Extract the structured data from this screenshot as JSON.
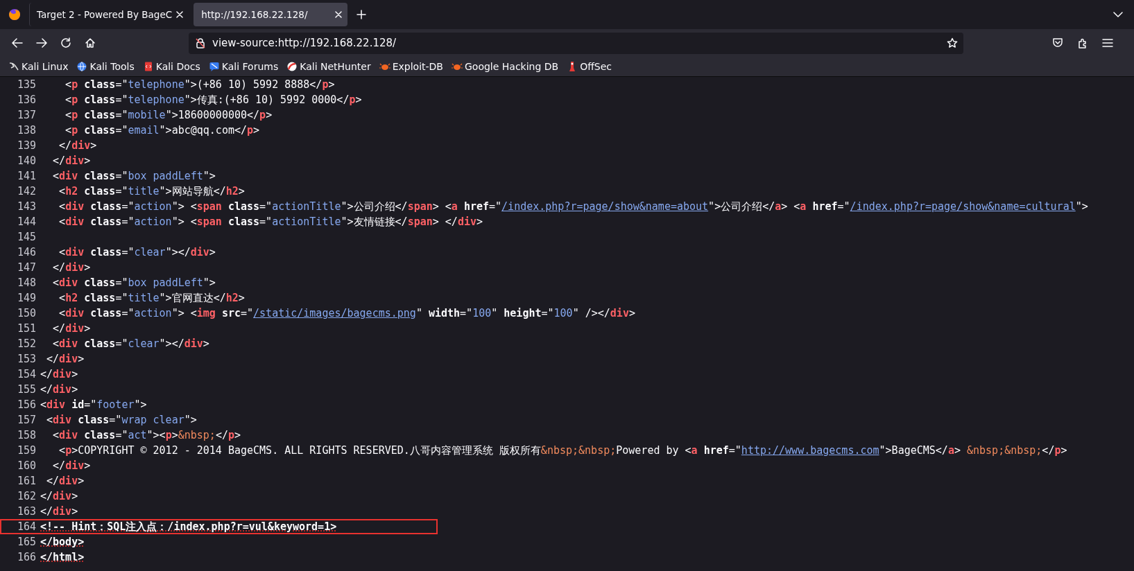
{
  "tabs": [
    {
      "title": "Target 2 - Powered By BageC",
      "selected": false
    },
    {
      "title": "http://192.168.22.128/",
      "selected": true
    }
  ],
  "address_bar": {
    "value": "view-source:http://192.168.22.128/"
  },
  "bookmarks": [
    {
      "label": "Kali Linux"
    },
    {
      "label": "Kali Tools"
    },
    {
      "label": "Kali Docs"
    },
    {
      "label": "Kali Forums"
    },
    {
      "label": "Kali NetHunter"
    },
    {
      "label": "Exploit-DB"
    },
    {
      "label": "Google Hacking DB"
    },
    {
      "label": "OffSec"
    }
  ],
  "source_lines": [
    {
      "number": "135",
      "highlighted": false,
      "tokens": [
        {
          "kind": "text",
          "text": "    <"
        },
        {
          "kind": "tag",
          "text": "p"
        },
        {
          "kind": "attr",
          "text": " class"
        },
        {
          "kind": "text",
          "text": "=\""
        },
        {
          "kind": "value",
          "text": "telephone"
        },
        {
          "kind": "text",
          "text": "\">(+86 10) 5992 8888</"
        },
        {
          "kind": "tag",
          "text": "p"
        },
        {
          "kind": "text",
          "text": ">"
        }
      ]
    },
    {
      "number": "136",
      "highlighted": false,
      "tokens": [
        {
          "kind": "text",
          "text": "    <"
        },
        {
          "kind": "tag",
          "text": "p"
        },
        {
          "kind": "attr",
          "text": " class"
        },
        {
          "kind": "text",
          "text": "=\""
        },
        {
          "kind": "value",
          "text": "telephone"
        },
        {
          "kind": "text",
          "text": "\">传真:(+86 10) 5992 0000</"
        },
        {
          "kind": "tag",
          "text": "p"
        },
        {
          "kind": "text",
          "text": ">"
        }
      ]
    },
    {
      "number": "137",
      "highlighted": false,
      "tokens": [
        {
          "kind": "text",
          "text": "    <"
        },
        {
          "kind": "tag",
          "text": "p"
        },
        {
          "kind": "attr",
          "text": " class"
        },
        {
          "kind": "text",
          "text": "=\""
        },
        {
          "kind": "value",
          "text": "mobile"
        },
        {
          "kind": "text",
          "text": "\">18600000000</"
        },
        {
          "kind": "tag",
          "text": "p"
        },
        {
          "kind": "text",
          "text": ">"
        }
      ]
    },
    {
      "number": "138",
      "highlighted": false,
      "tokens": [
        {
          "kind": "text",
          "text": "    <"
        },
        {
          "kind": "tag",
          "text": "p"
        },
        {
          "kind": "attr",
          "text": " class"
        },
        {
          "kind": "text",
          "text": "=\""
        },
        {
          "kind": "value",
          "text": "email"
        },
        {
          "kind": "text",
          "text": "\">abc@qq.com</"
        },
        {
          "kind": "tag",
          "text": "p"
        },
        {
          "kind": "text",
          "text": ">"
        }
      ]
    },
    {
      "number": "139",
      "highlighted": false,
      "tokens": [
        {
          "kind": "text",
          "text": "   </"
        },
        {
          "kind": "tag",
          "text": "div"
        },
        {
          "kind": "text",
          "text": ">"
        }
      ]
    },
    {
      "number": "140",
      "highlighted": false,
      "tokens": [
        {
          "kind": "text",
          "text": "  </"
        },
        {
          "kind": "tag",
          "text": "div"
        },
        {
          "kind": "text",
          "text": ">"
        }
      ]
    },
    {
      "number": "141",
      "highlighted": false,
      "tokens": [
        {
          "kind": "text",
          "text": "  <"
        },
        {
          "kind": "tag",
          "text": "div"
        },
        {
          "kind": "attr",
          "text": " class"
        },
        {
          "kind": "text",
          "text": "=\""
        },
        {
          "kind": "value",
          "text": "box paddLeft"
        },
        {
          "kind": "text",
          "text": "\">"
        }
      ]
    },
    {
      "number": "142",
      "highlighted": false,
      "tokens": [
        {
          "kind": "text",
          "text": "   <"
        },
        {
          "kind": "tag",
          "text": "h2"
        },
        {
          "kind": "attr",
          "text": " class"
        },
        {
          "kind": "text",
          "text": "=\""
        },
        {
          "kind": "value",
          "text": "title"
        },
        {
          "kind": "text",
          "text": "\">网站导航</"
        },
        {
          "kind": "tag",
          "text": "h2"
        },
        {
          "kind": "text",
          "text": ">"
        }
      ]
    },
    {
      "number": "143",
      "highlighted": false,
      "tokens": [
        {
          "kind": "text",
          "text": "   <"
        },
        {
          "kind": "tag",
          "text": "div"
        },
        {
          "kind": "attr",
          "text": " class"
        },
        {
          "kind": "text",
          "text": "=\""
        },
        {
          "kind": "value",
          "text": "action"
        },
        {
          "kind": "text",
          "text": "\"> <"
        },
        {
          "kind": "tag",
          "text": "span"
        },
        {
          "kind": "attr",
          "text": " class"
        },
        {
          "kind": "text",
          "text": "=\""
        },
        {
          "kind": "value",
          "text": "actionTitle"
        },
        {
          "kind": "text",
          "text": "\">公司介绍</"
        },
        {
          "kind": "tag",
          "text": "span"
        },
        {
          "kind": "text",
          "text": "> <"
        },
        {
          "kind": "tag",
          "text": "a"
        },
        {
          "kind": "attr",
          "text": " href"
        },
        {
          "kind": "text",
          "text": "=\""
        },
        {
          "kind": "link",
          "text": "/index.php?r=page/show&name=about"
        },
        {
          "kind": "text",
          "text": "\">公司介绍</"
        },
        {
          "kind": "tag",
          "text": "a"
        },
        {
          "kind": "text",
          "text": "> <"
        },
        {
          "kind": "tag",
          "text": "a"
        },
        {
          "kind": "attr",
          "text": " href"
        },
        {
          "kind": "text",
          "text": "=\""
        },
        {
          "kind": "link",
          "text": "/index.php?r=page/show&name=cultural"
        },
        {
          "kind": "text",
          "text": "\">"
        }
      ]
    },
    {
      "number": "144",
      "highlighted": false,
      "tokens": [
        {
          "kind": "text",
          "text": "   <"
        },
        {
          "kind": "tag",
          "text": "div"
        },
        {
          "kind": "attr",
          "text": " class"
        },
        {
          "kind": "text",
          "text": "=\""
        },
        {
          "kind": "value",
          "text": "action"
        },
        {
          "kind": "text",
          "text": "\"> <"
        },
        {
          "kind": "tag",
          "text": "span"
        },
        {
          "kind": "attr",
          "text": " class"
        },
        {
          "kind": "text",
          "text": "=\""
        },
        {
          "kind": "value",
          "text": "actionTitle"
        },
        {
          "kind": "text",
          "text": "\">友情链接</"
        },
        {
          "kind": "tag",
          "text": "span"
        },
        {
          "kind": "text",
          "text": "> </"
        },
        {
          "kind": "tag",
          "text": "div"
        },
        {
          "kind": "text",
          "text": ">"
        }
      ]
    },
    {
      "number": "145",
      "highlighted": false
    },
    {
      "number": "146",
      "highlighted": false,
      "tokens": [
        {
          "kind": "text",
          "text": "   <"
        },
        {
          "kind": "tag",
          "text": "div"
        },
        {
          "kind": "attr",
          "text": " class"
        },
        {
          "kind": "text",
          "text": "=\""
        },
        {
          "kind": "value",
          "text": "clear"
        },
        {
          "kind": "text",
          "text": "\"></"
        },
        {
          "kind": "tag",
          "text": "div"
        },
        {
          "kind": "text",
          "text": ">"
        }
      ]
    },
    {
      "number": "147",
      "highlighted": false,
      "tokens": [
        {
          "kind": "text",
          "text": "  </"
        },
        {
          "kind": "tag",
          "text": "div"
        },
        {
          "kind": "text",
          "text": ">"
        }
      ]
    },
    {
      "number": "148",
      "highlighted": false,
      "tokens": [
        {
          "kind": "text",
          "text": "  <"
        },
        {
          "kind": "tag",
          "text": "div"
        },
        {
          "kind": "attr",
          "text": " class"
        },
        {
          "kind": "text",
          "text": "=\""
        },
        {
          "kind": "value",
          "text": "box paddLeft"
        },
        {
          "kind": "text",
          "text": "\">"
        }
      ]
    },
    {
      "number": "149",
      "highlighted": false,
      "tokens": [
        {
          "kind": "text",
          "text": "   <"
        },
        {
          "kind": "tag",
          "text": "h2"
        },
        {
          "kind": "attr",
          "text": " class"
        },
        {
          "kind": "text",
          "text": "=\""
        },
        {
          "kind": "value",
          "text": "title"
        },
        {
          "kind": "text",
          "text": "\">官网直达</"
        },
        {
          "kind": "tag",
          "text": "h2"
        },
        {
          "kind": "text",
          "text": ">"
        }
      ]
    },
    {
      "number": "150",
      "highlighted": false,
      "tokens": [
        {
          "kind": "text",
          "text": "   <"
        },
        {
          "kind": "tag",
          "text": "div"
        },
        {
          "kind": "attr",
          "text": " class"
        },
        {
          "kind": "text",
          "text": "=\""
        },
        {
          "kind": "value",
          "text": "action"
        },
        {
          "kind": "text",
          "text": "\"> <"
        },
        {
          "kind": "tag",
          "text": "img"
        },
        {
          "kind": "attr",
          "text": " src"
        },
        {
          "kind": "text",
          "text": "=\""
        },
        {
          "kind": "link",
          "text": "/static/images/bagecms.png"
        },
        {
          "kind": "text",
          "text": "\""
        },
        {
          "kind": "attr",
          "text": " width"
        },
        {
          "kind": "text",
          "text": "=\""
        },
        {
          "kind": "value",
          "text": "100"
        },
        {
          "kind": "text",
          "text": "\""
        },
        {
          "kind": "attr",
          "text": " height"
        },
        {
          "kind": "text",
          "text": "=\""
        },
        {
          "kind": "value",
          "text": "100"
        },
        {
          "kind": "text",
          "text": "\" /></"
        },
        {
          "kind": "tag",
          "text": "div"
        },
        {
          "kind": "text",
          "text": ">"
        }
      ]
    },
    {
      "number": "151",
      "highlighted": false,
      "tokens": [
        {
          "kind": "text",
          "text": "  </"
        },
        {
          "kind": "tag",
          "text": "div"
        },
        {
          "kind": "text",
          "text": ">"
        }
      ]
    },
    {
      "number": "152",
      "highlighted": false,
      "tokens": [
        {
          "kind": "text",
          "text": "  <"
        },
        {
          "kind": "tag",
          "text": "div"
        },
        {
          "kind": "attr",
          "text": " class"
        },
        {
          "kind": "text",
          "text": "=\""
        },
        {
          "kind": "value",
          "text": "clear"
        },
        {
          "kind": "text",
          "text": "\"></"
        },
        {
          "kind": "tag",
          "text": "div"
        },
        {
          "kind": "text",
          "text": ">"
        }
      ]
    },
    {
      "number": "153",
      "highlighted": false,
      "tokens": [
        {
          "kind": "text",
          "text": " </"
        },
        {
          "kind": "tag",
          "text": "div"
        },
        {
          "kind": "text",
          "text": ">"
        }
      ]
    },
    {
      "number": "154",
      "highlighted": false,
      "tokens": [
        {
          "kind": "text",
          "text": "</"
        },
        {
          "kind": "tag",
          "text": "div"
        },
        {
          "kind": "text",
          "text": ">"
        }
      ]
    },
    {
      "number": "155",
      "highlighted": false,
      "tokens": [
        {
          "kind": "text",
          "text": "</"
        },
        {
          "kind": "tag",
          "text": "div"
        },
        {
          "kind": "text",
          "text": ">"
        }
      ]
    },
    {
      "number": "156",
      "highlighted": false,
      "tokens": [
        {
          "kind": "text",
          "text": "<"
        },
        {
          "kind": "tag",
          "text": "div"
        },
        {
          "kind": "attr",
          "text": " id"
        },
        {
          "kind": "text",
          "text": "=\""
        },
        {
          "kind": "value",
          "text": "footer"
        },
        {
          "kind": "text",
          "text": "\">"
        }
      ]
    },
    {
      "number": "157",
      "highlighted": false,
      "tokens": [
        {
          "kind": "text",
          "text": " <"
        },
        {
          "kind": "tag",
          "text": "div"
        },
        {
          "kind": "attr",
          "text": " class"
        },
        {
          "kind": "text",
          "text": "=\""
        },
        {
          "kind": "value",
          "text": "wrap clear"
        },
        {
          "kind": "text",
          "text": "\">"
        }
      ]
    },
    {
      "number": "158",
      "highlighted": false,
      "tokens": [
        {
          "kind": "text",
          "text": "  <"
        },
        {
          "kind": "tag",
          "text": "div"
        },
        {
          "kind": "attr",
          "text": " class"
        },
        {
          "kind": "text",
          "text": "=\""
        },
        {
          "kind": "value",
          "text": "act"
        },
        {
          "kind": "text",
          "text": "\"><"
        },
        {
          "kind": "tag",
          "text": "p"
        },
        {
          "kind": "text",
          "text": ">"
        },
        {
          "kind": "entity",
          "text": "&nbsp;"
        },
        {
          "kind": "text",
          "text": "</"
        },
        {
          "kind": "tag",
          "text": "p"
        },
        {
          "kind": "text",
          "text": ">"
        }
      ]
    },
    {
      "number": "159",
      "highlighted": false,
      "tokens": [
        {
          "kind": "text",
          "text": "   <"
        },
        {
          "kind": "tag",
          "text": "p"
        },
        {
          "kind": "text",
          "text": ">COPYRIGHT © 2012 - 2014 BageCMS. ALL RIGHTS RESERVED.八哥内容管理系统 版权所有"
        },
        {
          "kind": "entity",
          "text": "&nbsp;&nbsp;"
        },
        {
          "kind": "text",
          "text": "Powered by <"
        },
        {
          "kind": "tag",
          "text": "a"
        },
        {
          "kind": "attr",
          "text": " href"
        },
        {
          "kind": "text",
          "text": "=\""
        },
        {
          "kind": "link",
          "text": "http://www.bagecms.com"
        },
        {
          "kind": "text",
          "text": "\">BageCMS</"
        },
        {
          "kind": "tag",
          "text": "a"
        },
        {
          "kind": "text",
          "text": ">"
        },
        {
          "kind": "entity",
          "text": " &nbsp;&nbsp;"
        },
        {
          "kind": "text",
          "text": "</"
        },
        {
          "kind": "tag",
          "text": "p"
        },
        {
          "kind": "text",
          "text": ">"
        }
      ]
    },
    {
      "number": "160",
      "highlighted": false,
      "tokens": [
        {
          "kind": "text",
          "text": "  </"
        },
        {
          "kind": "tag",
          "text": "div"
        },
        {
          "kind": "text",
          "text": ">"
        }
      ]
    },
    {
      "number": "161",
      "highlighted": false,
      "tokens": [
        {
          "kind": "text",
          "text": " </"
        },
        {
          "kind": "tag",
          "text": "div"
        },
        {
          "kind": "text",
          "text": ">"
        }
      ]
    },
    {
      "number": "162",
      "highlighted": false,
      "tokens": [
        {
          "kind": "text",
          "text": "</"
        },
        {
          "kind": "tag",
          "text": "div"
        },
        {
          "kind": "text",
          "text": ">"
        }
      ]
    },
    {
      "number": "163",
      "highlighted": false,
      "tokens": [
        {
          "kind": "text",
          "text": "</"
        },
        {
          "kind": "tag",
          "text": "div"
        },
        {
          "kind": "text",
          "text": ">"
        }
      ]
    },
    {
      "number": "164",
      "highlighted": true,
      "tokens": [
        {
          "kind": "error",
          "text": "<!-- Hint：SQL注入点：/index.php?r=vul&keyword=1>"
        }
      ]
    },
    {
      "number": "165",
      "highlighted": false,
      "tokens": [
        {
          "kind": "error",
          "text": "</body>"
        }
      ]
    },
    {
      "number": "166",
      "highlighted": false,
      "tokens": [
        {
          "kind": "error",
          "text": "</html>"
        }
      ]
    }
  ]
}
